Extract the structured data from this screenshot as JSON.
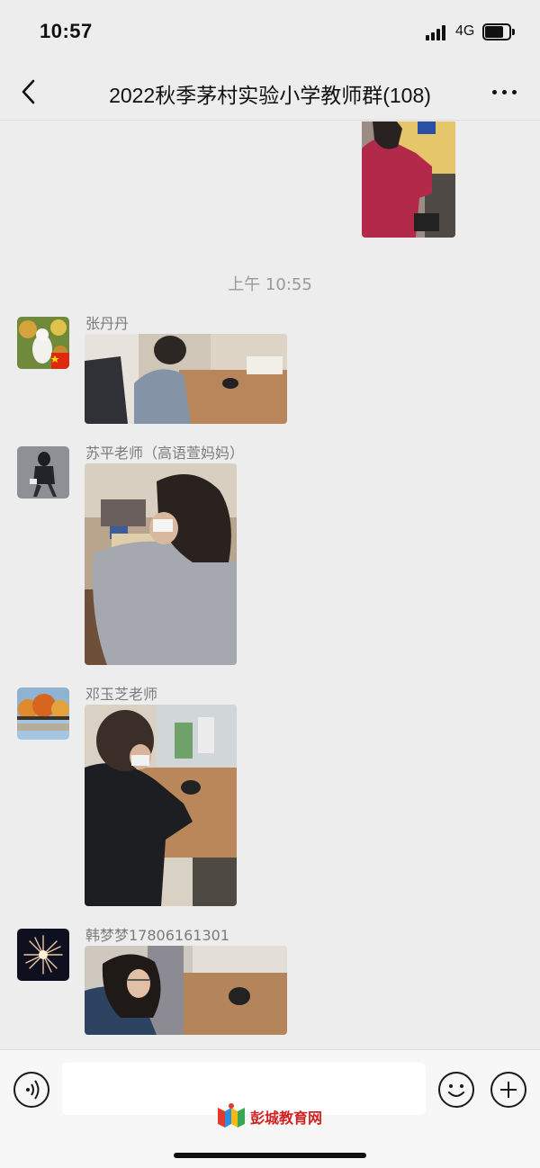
{
  "status_bar": {
    "time": "10:57",
    "network": "4G",
    "battery_level": 0.75
  },
  "header": {
    "title": "2022秋季茅村实验小学教师群(108)"
  },
  "chat": {
    "timestamp": "上午 10:55",
    "messages": [
      {
        "sender": "张丹丹",
        "avatar": "avatar-cat-flowers"
      },
      {
        "sender": "苏平老师（高语萱妈妈）",
        "avatar": "avatar-girl-walking"
      },
      {
        "sender": "邓玉芝老师",
        "avatar": "avatar-autumn-trees"
      },
      {
        "sender": "韩梦梦17806161301",
        "avatar": "avatar-fireworks"
      }
    ]
  },
  "input_bar": {
    "voice_icon": "voice-icon",
    "emoji_icon": "emoji-icon",
    "plus_icon": "plus-icon"
  },
  "watermark": {
    "text": "彭城教育网"
  }
}
